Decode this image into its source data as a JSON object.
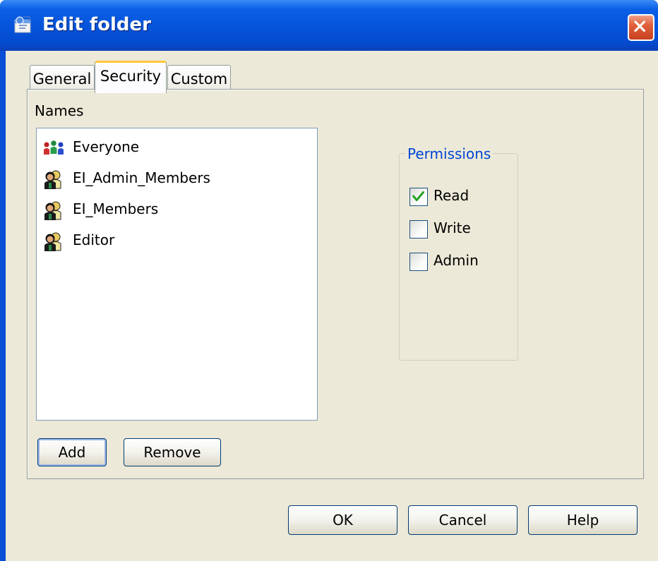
{
  "window": {
    "title": "Edit folder",
    "title_icon": "folder-edit-icon"
  },
  "tabs": [
    {
      "label": "General",
      "active": false
    },
    {
      "label": "Security",
      "active": true
    },
    {
      "label": "Custom",
      "active": false
    }
  ],
  "security": {
    "names_label": "Names",
    "names": [
      {
        "label": "Everyone",
        "icon": "group-icon"
      },
      {
        "label": "EI_Admin_Members",
        "icon": "user-group-icon"
      },
      {
        "label": "EI_Members",
        "icon": "user-group-icon"
      },
      {
        "label": "Editor",
        "icon": "user-group-icon"
      }
    ],
    "add_label": "Add",
    "remove_label": "Remove",
    "permissions": {
      "legend": "Permissions",
      "items": [
        {
          "label": "Read",
          "checked": true
        },
        {
          "label": "Write",
          "checked": false
        },
        {
          "label": "Admin",
          "checked": false
        }
      ]
    }
  },
  "footer": {
    "ok_label": "OK",
    "cancel_label": "Cancel",
    "help_label": "Help"
  },
  "colors": {
    "titlebar": "#0553d9",
    "dialog_bg": "#ece9d8",
    "legend_text": "#0046d5",
    "active_tab_accent": "#ffc83c",
    "check_mark": "#21a121"
  }
}
